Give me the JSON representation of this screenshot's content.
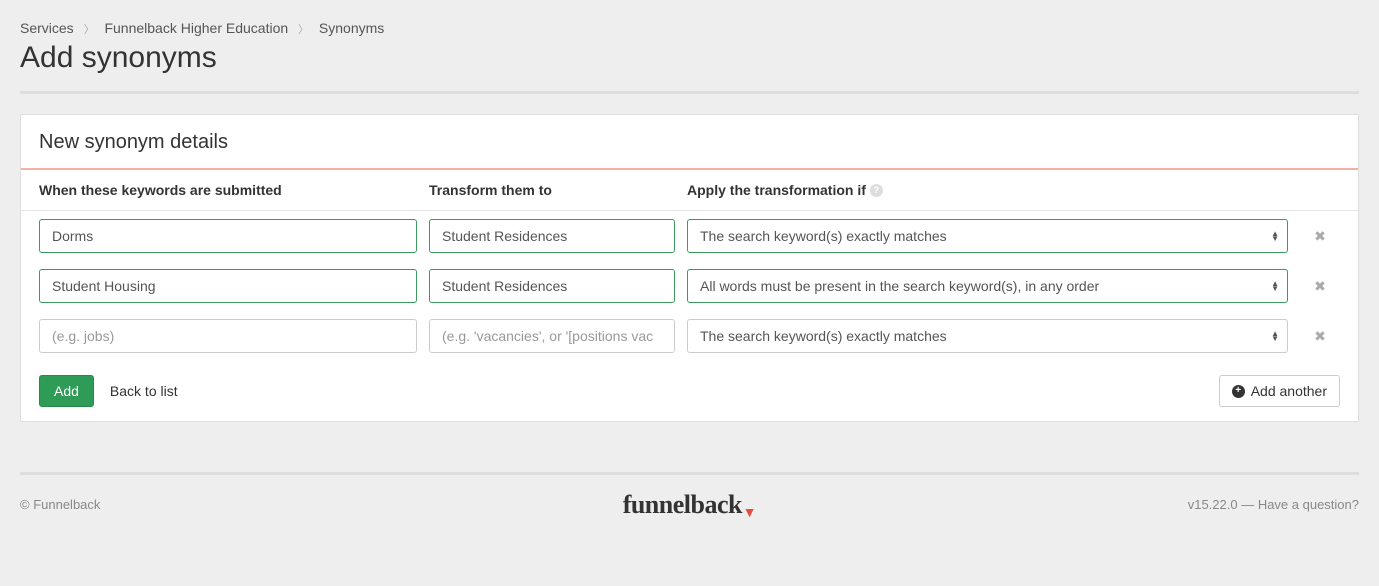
{
  "breadcrumb": {
    "items": [
      "Services",
      "Funnelback Higher Education",
      "Synonyms"
    ]
  },
  "page_title": "Add synonyms",
  "panel": {
    "header": "New synonym details",
    "columns": {
      "keywords": "When these keywords are submitted",
      "transform": "Transform them to",
      "apply": "Apply the transformation if"
    },
    "placeholders": {
      "keywords": "(e.g. jobs)",
      "transform": "(e.g. 'vacancies', or '[positions vac"
    },
    "rows": [
      {
        "keywords": "Dorms",
        "transform": "Student Residences",
        "apply": "The search keyword(s) exactly matches",
        "filled": true
      },
      {
        "keywords": "Student Housing",
        "transform": "Student Residences",
        "apply": "All words must be present in the search keyword(s), in any order",
        "filled": true
      },
      {
        "keywords": "",
        "transform": "",
        "apply": "The search keyword(s) exactly matches",
        "filled": false
      }
    ],
    "add_button": "Add",
    "back_link": "Back to list",
    "add_another": "Add another"
  },
  "footer": {
    "copyright": "© Funnelback",
    "brand": "funnelback",
    "version": "v15.22.0 — Have a question?"
  }
}
